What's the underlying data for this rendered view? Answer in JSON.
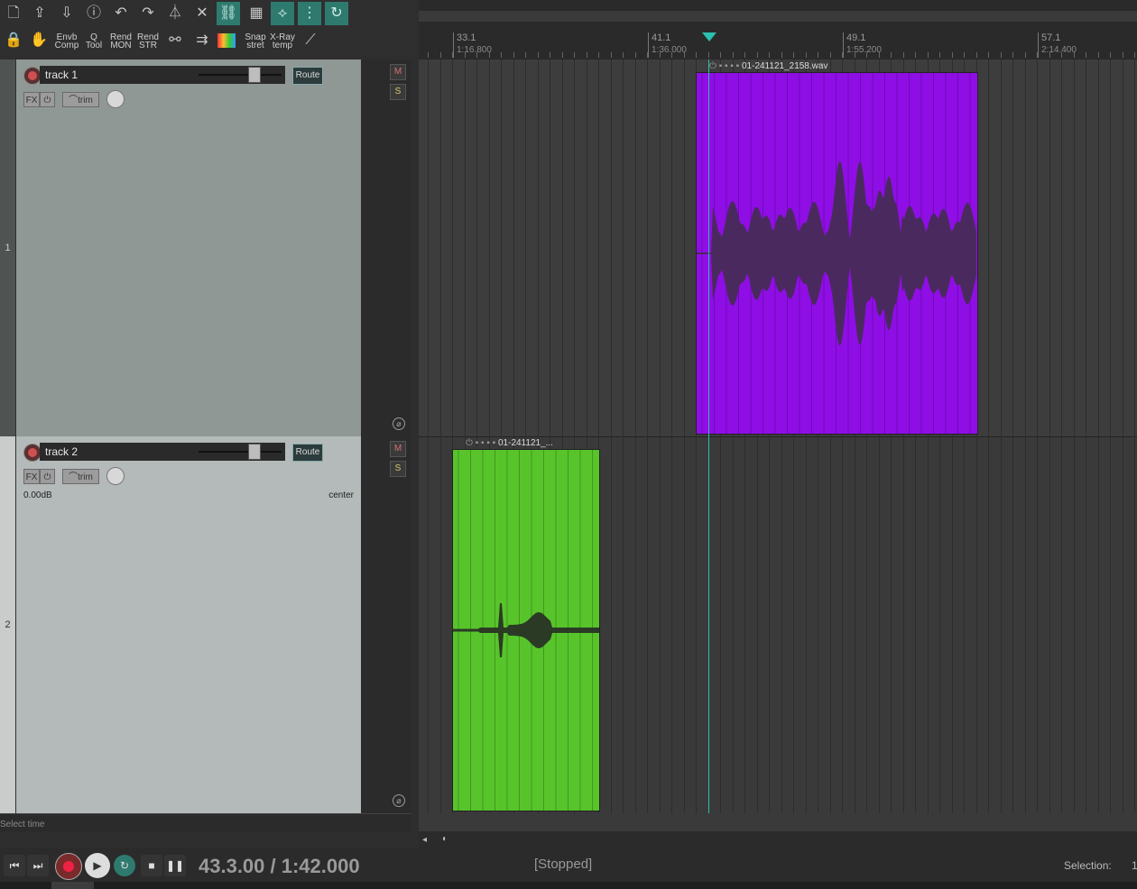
{
  "toolbar": {
    "row2_labels": [
      {
        "line1": "Envb",
        "line2": "Comp"
      },
      {
        "line1": "Q",
        "line2": "Tool"
      },
      {
        "line1": "Rend",
        "line2": "MON"
      },
      {
        "line1": "Rend",
        "line2": "STR"
      },
      {
        "line1": "Snap",
        "line2": "stret"
      },
      {
        "line1": "X-Ray",
        "line2": "temp"
      }
    ]
  },
  "ruler": {
    "marks": [
      {
        "measure": "33.1",
        "time": "1:16.800"
      },
      {
        "measure": "41.1",
        "time": "1:36.000"
      },
      {
        "measure": "49.1",
        "time": "1:55.200"
      },
      {
        "measure": "57.1",
        "time": "2:14.400"
      }
    ]
  },
  "tracks": [
    {
      "number": "1",
      "name": "track 1",
      "route_label": "Route",
      "fx_label": "FX",
      "trim_label": "trim",
      "mute_label": "M",
      "solo_label": "S",
      "phase_label": "⌀",
      "volume_text": "",
      "pan_text": "",
      "item": {
        "name": "01-241121_2158.wav",
        "color": "#8f0ee5"
      }
    },
    {
      "number": "2",
      "name": "track 2",
      "route_label": "Route",
      "fx_label": "FX",
      "trim_label": "trim",
      "mute_label": "M",
      "solo_label": "S",
      "phase_label": "⌀",
      "volume_text": "0.00dB",
      "pan_text": "center",
      "item": {
        "name": "01-241121_...",
        "color": "#58c42b"
      }
    }
  ],
  "status": {
    "hint": "Select time"
  },
  "transport": {
    "position": "43.3.00 / 1:42.000",
    "state": "[Stopped]",
    "selection_label": "Selection:",
    "selection_value": "1"
  },
  "colors": {
    "accent": "#2dbfae",
    "track_panel": "#8f9895",
    "track_panel_selected": "#b4bab9"
  }
}
